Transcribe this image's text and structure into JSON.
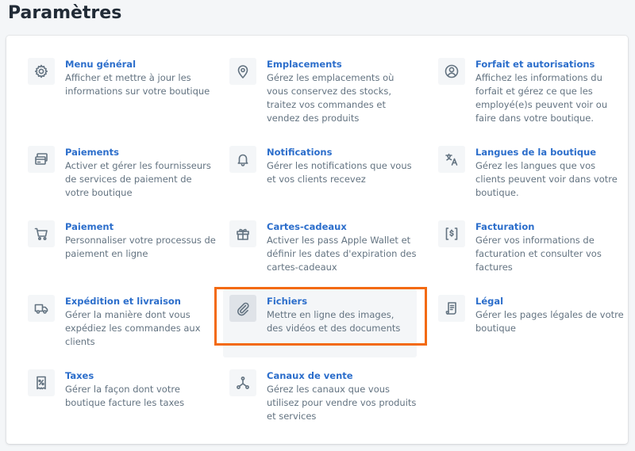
{
  "page": {
    "title": "Paramètres"
  },
  "settings": [
    {
      "key": "general",
      "title": "Menu général",
      "desc": "Afficher et mettre à jour les informations sur votre boutique",
      "icon": "gear-icon"
    },
    {
      "key": "locations",
      "title": "Emplacements",
      "desc": "Gérez les emplacements où vous conservez des stocks, traitez vos commandes et vendez des produits",
      "icon": "location-pin-icon"
    },
    {
      "key": "plan",
      "title": "Forfait et autorisations",
      "desc": "Affichez les informations du forfait et gérez ce que les employé(e)s peuvent voir ou faire dans votre boutique.",
      "icon": "user-circle-icon"
    },
    {
      "key": "payments",
      "title": "Paiements",
      "desc": "Activer et gérer les fournisseurs de services de paiement de votre boutique",
      "icon": "credit-card-icon"
    },
    {
      "key": "notifications",
      "title": "Notifications",
      "desc": "Gérer les notifications que vous et vos clients recevez",
      "icon": "bell-icon"
    },
    {
      "key": "languages",
      "title": "Langues de la boutique",
      "desc": "Gérez les langues que vos clients peuvent voir dans votre boutique.",
      "icon": "translate-icon"
    },
    {
      "key": "checkout",
      "title": "Paiement",
      "desc": "Personnaliser votre processus de paiement en ligne",
      "icon": "cart-icon"
    },
    {
      "key": "giftcards",
      "title": "Cartes-cadeaux",
      "desc": "Activer les pass Apple Wallet et définir les dates d'expiration des cartes-cadeaux",
      "icon": "gift-icon"
    },
    {
      "key": "billing",
      "title": "Facturation",
      "desc": "Gérer vos informations de facturation et consulter vos factures",
      "icon": "dollar-receipt-icon"
    },
    {
      "key": "shipping",
      "title": "Expédition et livraison",
      "desc": "Gérer la manière dont vous expédiez les commandes aux clients",
      "icon": "truck-icon"
    },
    {
      "key": "files",
      "title": "Fichiers",
      "desc": "Mettre en ligne des images, des vidéos et des documents",
      "icon": "paperclip-icon"
    },
    {
      "key": "legal",
      "title": "Légal",
      "desc": "Gérer les pages légales de votre boutique",
      "icon": "document-icon"
    },
    {
      "key": "taxes",
      "title": "Taxes",
      "desc": "Gérer la façon dont votre boutique facture les taxes",
      "icon": "percent-receipt-icon"
    },
    {
      "key": "channels",
      "title": "Canaux de vente",
      "desc": "Gérez les canaux que vous utilisez pour vendre vos produits et services",
      "icon": "channels-icon"
    }
  ],
  "colors": {
    "link": "#2c6ecb",
    "text_subdued": "#637381",
    "highlight": "#f36a10"
  }
}
